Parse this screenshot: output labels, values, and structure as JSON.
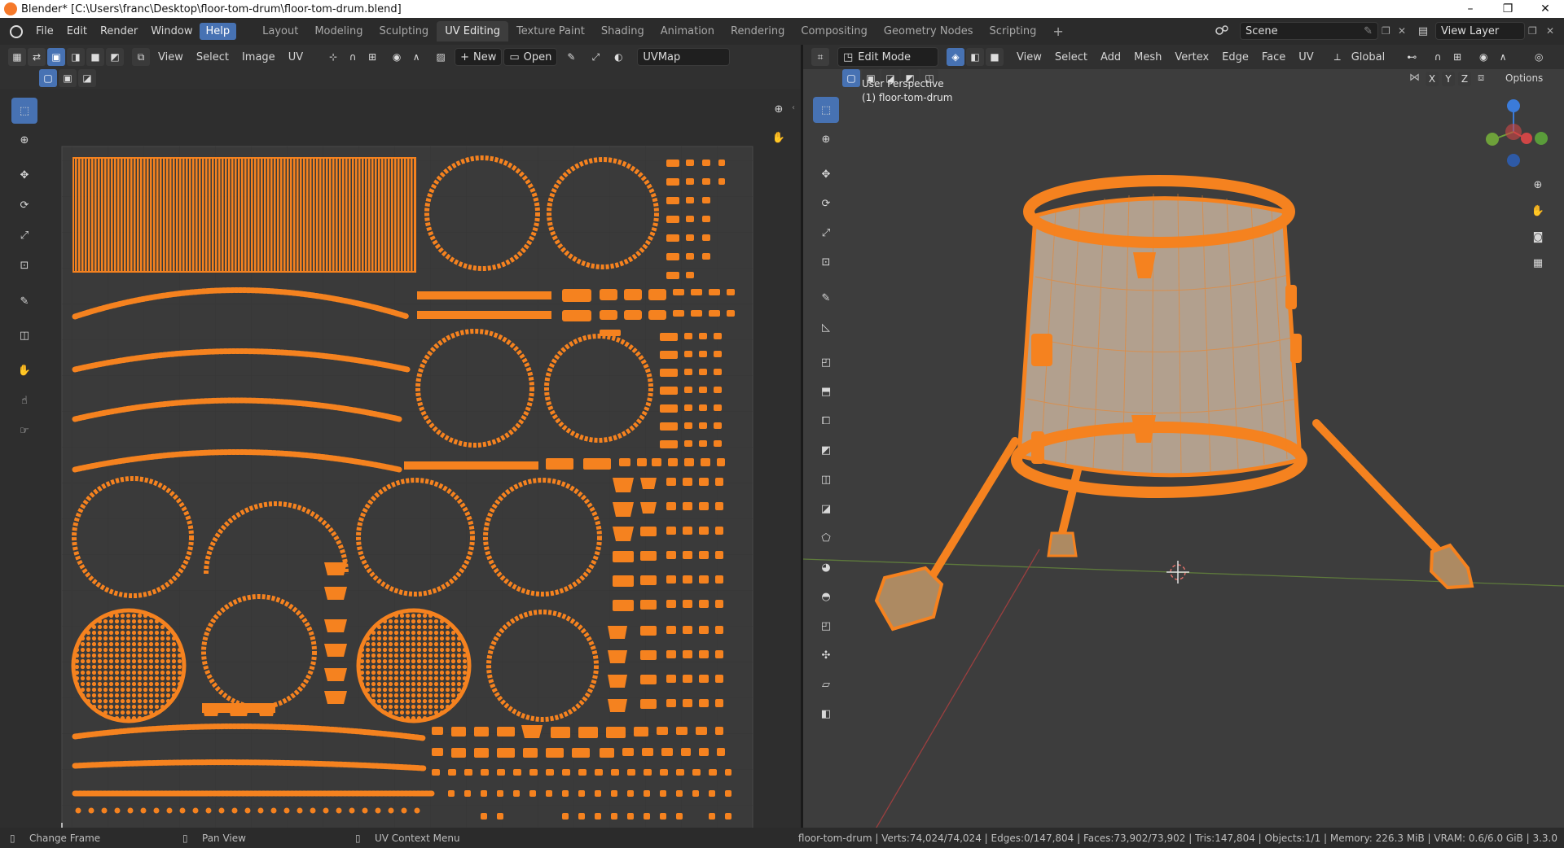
{
  "window": {
    "title": "Blender* [C:\\Users\\franc\\Desktop\\floor-tom-drum\\floor-tom-drum.blend]",
    "minimize_glyph": "–",
    "restore_glyph": "❐",
    "close_glyph": "✕"
  },
  "menu": [
    "File",
    "Edit",
    "Render",
    "Window",
    "Help"
  ],
  "workspaces": [
    "Layout",
    "Modeling",
    "Sculpting",
    "UV Editing",
    "Texture Paint",
    "Shading",
    "Animation",
    "Rendering",
    "Compositing",
    "Geometry Nodes",
    "Scripting"
  ],
  "workspace_add": "+",
  "scene": {
    "name": "Scene",
    "view_layer": "View Layer"
  },
  "uv_editor": {
    "menus": [
      "View",
      "Select",
      "Image",
      "UV"
    ],
    "new_label": "New",
    "open_label": "Open",
    "uvmap": "UVMap"
  },
  "viewport": {
    "mode": "Edit Mode",
    "menus": [
      "View",
      "Select",
      "Add",
      "Mesh",
      "Vertex",
      "Edge",
      "Face",
      "UV"
    ],
    "orientation": "Global",
    "options_label": "Options",
    "axis_x": "X",
    "axis_y": "Y",
    "axis_z": "Z",
    "perspective": "User Perspective",
    "object_label": "(1) floor-tom-drum"
  },
  "status": {
    "change_frame": "Change Frame",
    "pan_view": "Pan View",
    "uv_context": "UV Context Menu",
    "stats": "floor-tom-drum | Verts:74,024/74,024 | Edges:0/147,804 | Faces:73,902/73,902 | Tris:147,804 | Objects:1/1 | Memory: 226.3 MiB | VRAM: 0.6/6.0 GiB | 3.3.0"
  },
  "colors": {
    "accent": "#4772b3",
    "uv_orange": "#f5821f",
    "panel_bg": "#303030",
    "viewport_bg": "#3d3d3d"
  }
}
